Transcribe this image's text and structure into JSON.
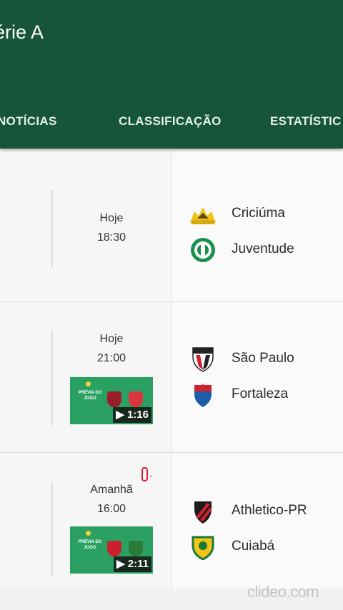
{
  "header": {
    "title": "érie A",
    "tabs": [
      {
        "label": "NOTÍCIAS"
      },
      {
        "label": "CLASSIFICAÇÃO"
      },
      {
        "label": "ESTATÍSTIC"
      }
    ]
  },
  "matches": [
    {
      "day": "Hoje",
      "time": "18:30",
      "home": "Criciúma",
      "away": "Juventude"
    },
    {
      "day": "Hoje",
      "time": "21:00",
      "video_duration": "▶ 1:16",
      "video_caption": "PRÉVIA DO JOGO",
      "home": "São Paulo",
      "away": "Fortaleza"
    },
    {
      "day": "Amanhã",
      "time": "16:00",
      "video_duration": "▶ 2:11",
      "video_caption": "PRÉVIA DO JOGO",
      "home": "Athletico-PR",
      "away": "Cuiabá"
    }
  ],
  "colors": {
    "header_bg": "#17553a",
    "thumb_bg": "#2aa162"
  },
  "watermark": "clideo.com"
}
